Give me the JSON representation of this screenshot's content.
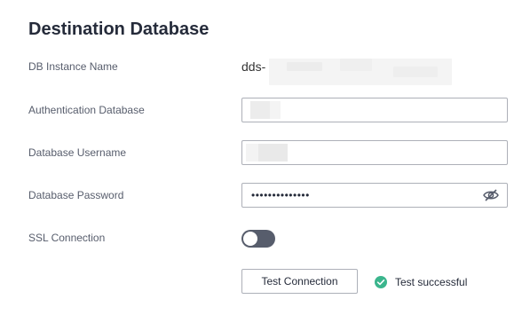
{
  "section": {
    "title": "Destination Database"
  },
  "fields": {
    "db_instance": {
      "label": "DB Instance Name",
      "value": "dds-"
    },
    "auth_database": {
      "label": "Authentication Database",
      "value": ""
    },
    "username": {
      "label": "Database Username",
      "value": ""
    },
    "password": {
      "label": "Database Password",
      "value": "••••••••••••••",
      "toggle_icon": "eye-slash-icon"
    },
    "ssl": {
      "label": "SSL Connection",
      "enabled": false
    }
  },
  "actions": {
    "test_connection_label": "Test Connection",
    "status_text": "Test successful",
    "status_icon": "check-circle-icon",
    "status_color": "#3bb58d"
  },
  "colors": {
    "title": "#252b3a",
    "label": "#575d6c",
    "input_border": "#adb0b8",
    "switch_off": "#575d6c",
    "success": "#3bb58d"
  }
}
